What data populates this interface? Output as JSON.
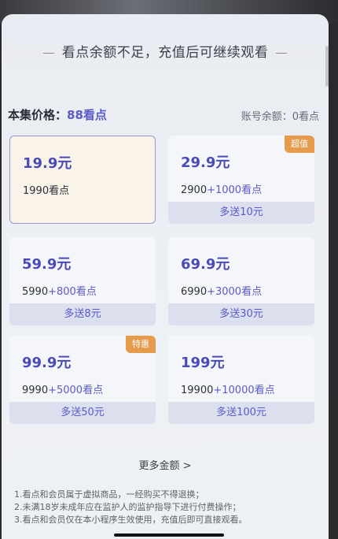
{
  "header": {
    "title": "看点余额不足，充值后可继续观看"
  },
  "price": {
    "label": "本集价格：",
    "value": "88看点"
  },
  "balance": {
    "text": "账号余额：0看点"
  },
  "packages": [
    {
      "amount": "19.9元",
      "base": "1990看点",
      "bonus": "",
      "extra": "",
      "tag": ""
    },
    {
      "amount": "29.9元",
      "base": "2900",
      "bonus": "+1000看点",
      "extra": "多送10元",
      "tag": "超值"
    },
    {
      "amount": "59.9元",
      "base": "5990",
      "bonus": "+800看点",
      "extra": "多送8元",
      "tag": ""
    },
    {
      "amount": "69.9元",
      "base": "6990",
      "bonus": "+3000看点",
      "extra": "多送30元",
      "tag": ""
    },
    {
      "amount": "99.9元",
      "base": "9990",
      "bonus": "+5000看点",
      "extra": "多送50元",
      "tag": "特惠"
    },
    {
      "amount": "199元",
      "base": "19900",
      "bonus": "+10000看点",
      "extra": "多送100元",
      "tag": ""
    }
  ],
  "more": {
    "label": "更多金额",
    "chevron": ">"
  },
  "notes": [
    "1.看点和会员属于虚拟商品，一经购买不得退换；",
    "2.未满18岁未成年应在监护人的监护指导下进行付费操作；",
    "3.看点和会员仅在本小程序生效使用，充值后即可直接观看。"
  ]
}
